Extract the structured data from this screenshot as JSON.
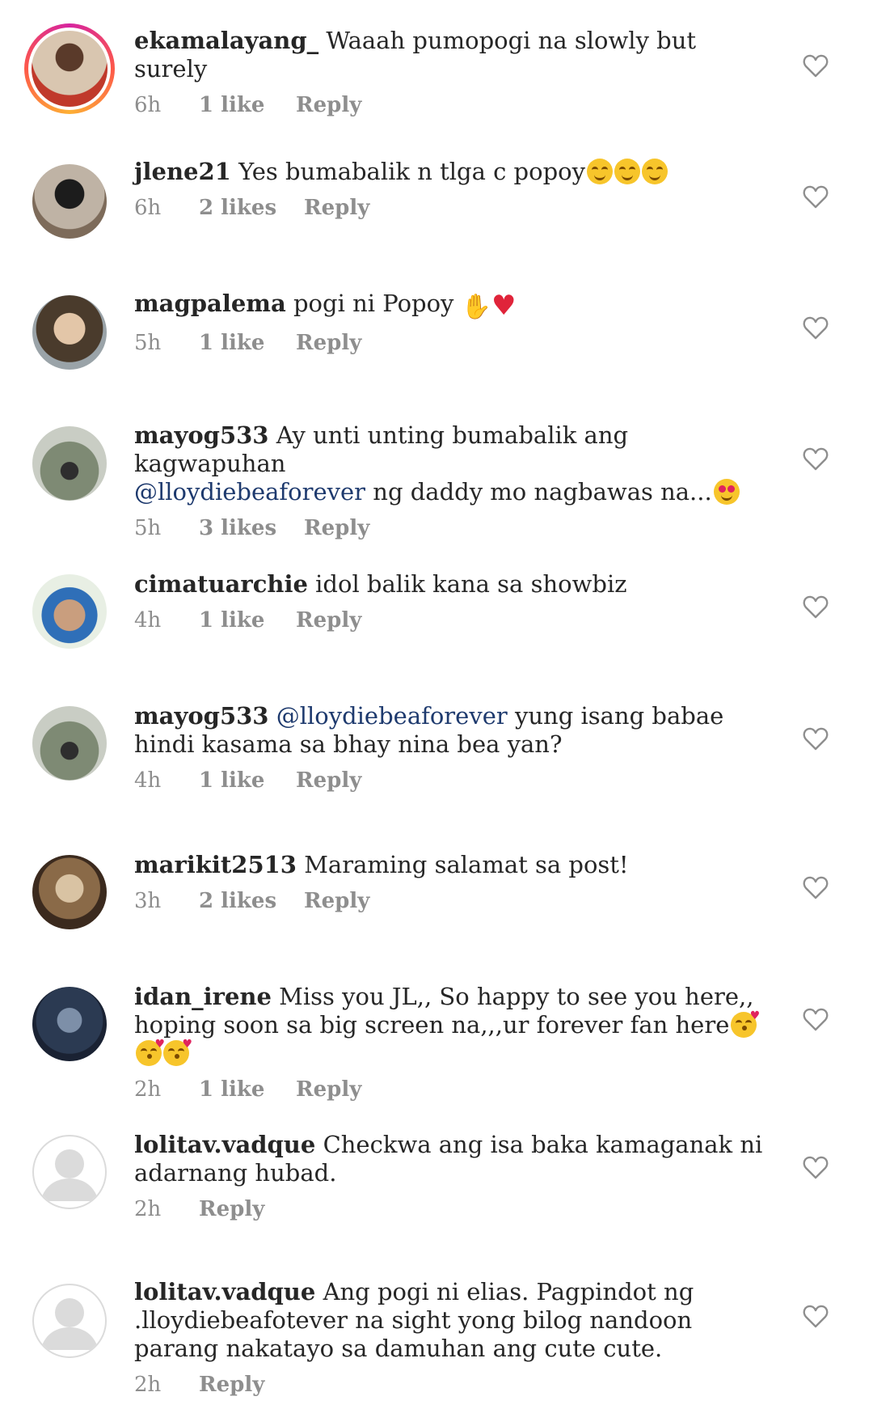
{
  "comments": [
    {
      "username": "ekamalayang_",
      "text": "Waaah pumopogi na slowly but surely",
      "time": "6h",
      "likes": "1 like",
      "reply": "Reply",
      "avatar_color": "#c98a5a",
      "story_ring": true
    },
    {
      "username": "jlene21",
      "text": "Yes bumabalik n tlga c popoy",
      "emoji": [
        "smiling-face-icon",
        "smiling-face-icon",
        "smiling-face-icon"
      ],
      "time": "6h",
      "likes": "2 likes",
      "reply": "Reply",
      "avatar_color": "#8a7766"
    },
    {
      "username": "magpalema",
      "text": "pogi ni Popoy",
      "emoji": [
        "clapping-hands-icon",
        "red-heart-icon"
      ],
      "time": "5h",
      "likes": "1 like",
      "reply": "Reply",
      "avatar_color": "#6b5a45"
    },
    {
      "username": "mayog533",
      "text_before": "Ay unti unting bumabalik ang kagwapuhan",
      "mention": "@lloydiebeaforever",
      "text_after": " ng daddy mo nagbawas na...",
      "emoji": [
        "heart-eyes-face-icon"
      ],
      "time": "5h",
      "likes": "3 likes",
      "reply": "Reply",
      "avatar_color": "#5e6a55"
    },
    {
      "username": "cimatuarchie",
      "text": "idol balik kana sa showbiz",
      "time": "4h",
      "likes": "1 like",
      "reply": "Reply",
      "avatar_color": "#3f7fbf"
    },
    {
      "username": "mayog533",
      "mention": "@lloydiebeaforever",
      "text_after": "yung isang babae hindi kasama sa bhay nina bea yan?",
      "time": "4h",
      "likes": "1 like",
      "reply": "Reply",
      "avatar_color": "#5e6a55"
    },
    {
      "username": "marikit2513",
      "text": "Maraming salamat sa post!",
      "time": "3h",
      "likes": "2 likes",
      "reply": "Reply",
      "avatar_color": "#8b6f52"
    },
    {
      "username": "idan_irene",
      "text": "Miss you JL,, So happy to see you here,, hoping soon sa big screen na,,,ur forever fan here",
      "emoji": [
        "kissing-face-icon",
        "kissing-face-icon",
        "kissing-face-icon"
      ],
      "time": "2h",
      "likes": "1 like",
      "reply": "Reply",
      "avatar_color": "#2b3a52"
    },
    {
      "username": "lolitav.vadque",
      "text": "Checkwa ang isa baka kamaganak ni adarnang hubad.",
      "time": "2h",
      "reply": "Reply",
      "avatar_color": "#dbdbdb",
      "default_avatar": true
    },
    {
      "username": "lolitav.vadque",
      "text": "Ang pogi ni elias. Pagpindot ng .lloydiebeafotever na sight yong bilog nandoon parang nakatayo sa damuhan ang cute cute.",
      "time": "2h",
      "reply": "Reply",
      "avatar_color": "#dbdbdb",
      "default_avatar": true
    }
  ]
}
